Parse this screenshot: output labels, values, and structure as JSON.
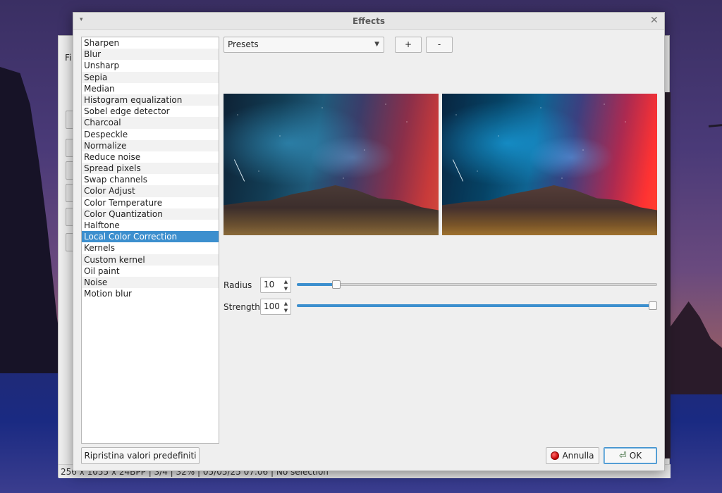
{
  "background_window": {
    "menu_partial": "Fi",
    "status_partial": "256  x 1055 x 24BPP  |  3/4  |  32%  |  05/05/25 07:06  |  No selection"
  },
  "dialog": {
    "title": "Effects",
    "menu_arrow": "▾",
    "close_glyph": "✕"
  },
  "effects": {
    "items": [
      "Sharpen",
      "Blur",
      "Unsharp",
      "Sepia",
      "Median",
      "Histogram equalization",
      "Sobel edge detector",
      "Charcoal",
      "Despeckle",
      "Normalize",
      "Reduce noise",
      "Spread pixels",
      "Swap channels",
      "Color Adjust",
      "Color Temperature",
      "Color Quantization",
      "Halftone",
      "Local Color Correction",
      "Kernels",
      "Custom kernel",
      "Oil paint",
      "Noise",
      "Motion blur"
    ],
    "selected": "Local Color Correction"
  },
  "presets": {
    "selected": "Presets",
    "add_label": "+",
    "remove_label": "-"
  },
  "params": {
    "radius_label": "Radius",
    "radius_value": "10",
    "radius_fraction": 0.1,
    "strength_label": "Strength",
    "strength_value": "100",
    "strength_fraction": 1.0
  },
  "footer": {
    "reset_label": "Ripristina valori predefiniti",
    "cancel_label": "Annulla",
    "ok_label": "OK"
  },
  "colors": {
    "accent": "#3c8fce",
    "cancel_icon": "#c40000"
  }
}
